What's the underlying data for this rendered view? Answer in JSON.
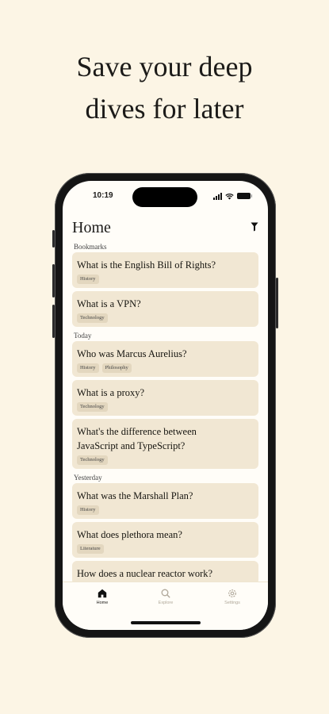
{
  "headline": {
    "line1": "Save your deep",
    "line2": "dives for later"
  },
  "status_bar": {
    "time": "10:19"
  },
  "header": {
    "title": "Home",
    "filter_icon": "filter-icon"
  },
  "sections": {
    "bookmarks": {
      "label": "Bookmarks",
      "items": [
        {
          "title": "What is the English Bill of Rights?",
          "tags": [
            "History"
          ]
        },
        {
          "title": "What is a VPN?",
          "tags": [
            "Technology"
          ]
        }
      ]
    },
    "today": {
      "label": "Today",
      "items": [
        {
          "title": "Who was Marcus Aurelius?",
          "tags": [
            "History",
            "Philosophy"
          ]
        },
        {
          "title": "What is a proxy?",
          "tags": [
            "Technology"
          ]
        },
        {
          "title_line1": "What's the difference between",
          "title_line2": "JavaScript and TypeScript?",
          "tags": [
            "Technology"
          ]
        }
      ]
    },
    "yesterday": {
      "label": "Yesterday",
      "items": [
        {
          "title": "What was the Marshall Plan?",
          "tags": [
            "History"
          ]
        },
        {
          "title": "What does plethora mean?",
          "tags": [
            "Literature"
          ]
        },
        {
          "title": "How does a nuclear reactor work?"
        }
      ]
    }
  },
  "tabbar": {
    "home": {
      "label": "Home",
      "icon": "home-icon"
    },
    "explore": {
      "label": "Explore",
      "icon": "search-icon"
    },
    "settings": {
      "label": "Settings",
      "icon": "gear-icon"
    }
  },
  "colors": {
    "background": "#fcf5e5",
    "card": "#f1e7d3",
    "tag": "#e3d7bf",
    "inactive_tab": "#b0a89a"
  }
}
